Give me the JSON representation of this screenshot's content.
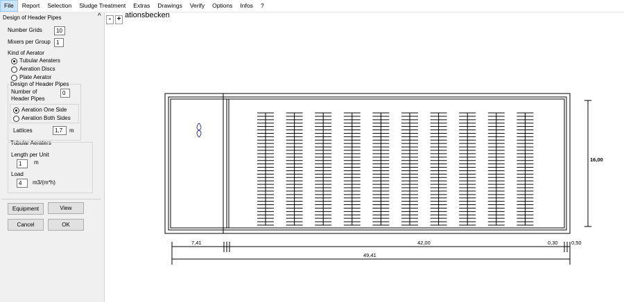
{
  "menu": [
    "File",
    "Report",
    "Selection",
    "Sludge Treatment",
    "Extras",
    "Drawings",
    "Verify",
    "Options",
    "Infos",
    "?"
  ],
  "panel": {
    "title": "Design of Header Pipes",
    "number_grids_label": "Number Grids",
    "number_grids_value": "10",
    "mixers_label": "Mixers per Group",
    "mixers_value": "1",
    "kind_label": "Kind of Aerator",
    "aerators": [
      "Tubular Aeraters",
      "Aeration Discs",
      "Plate Aerator"
    ],
    "aerator_selected": 0,
    "header_group_title": "Design of Header Pipes",
    "number_of_label_1": "Number of",
    "number_of_label_2": "Header Pipes",
    "header_pipes_value": "0",
    "sides": [
      "Aeration One Side",
      "Aeration Both Sides"
    ],
    "side_selected": 0,
    "lattices_label": "Lattices",
    "lattices_value": "1,7",
    "lattices_unit": "m",
    "tubular_title": "Tubular Aeraters",
    "length_label": "Length per Unit",
    "length_value": "1",
    "length_unit": "m",
    "load_label": "Load",
    "load_value": "4",
    "load_unit": "m3/(m*h)"
  },
  "buttons": {
    "equipment": "Equipment",
    "view": "View",
    "cancel": "Cancel",
    "ok": "OK"
  },
  "collapse_glyph": "^",
  "zoom": {
    "minus": "-",
    "plus": "+"
  },
  "drawing": {
    "title_fragment": "ationsbecken",
    "grid_count": 10,
    "dim_height": "16,00",
    "dim_left": "7,41",
    "dim_main": "42,00",
    "dim_right_a": "0,30",
    "dim_right_b": "0,50",
    "dim_total": "49,41"
  }
}
